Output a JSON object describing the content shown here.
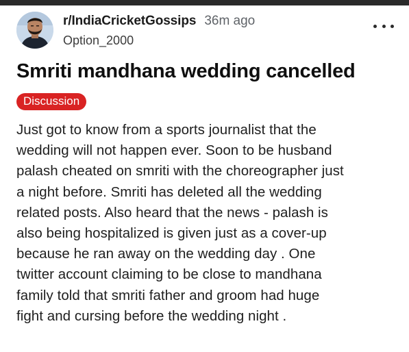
{
  "post": {
    "subreddit": "r/IndiaCricketGossips",
    "time_ago": "36m ago",
    "username": "Option_2000",
    "title": "Smriti mandhana wedding cancelled",
    "flair": "Discussion",
    "body_lines": [
      "Just got to know from a sports journalist that the",
      "wedding will not happen ever. Soon to be husband",
      "palash cheated on smriti with the choreographer just",
      "a night before. Smriti has deleted all the wedding",
      "related posts. Also heard that the news - palash is",
      "also being hospitalized is given just as a cover-up",
      "because he ran away on the wedding day . One",
      "twitter account claiming to be close to mandhana",
      "family told that smriti father and groom had huge",
      "fight and cursing before the wedding night ."
    ],
    "icons": {
      "avatar": "user-avatar",
      "more": "more-options-icon"
    },
    "colors": {
      "flair_bg": "#d92323",
      "text": "#1e1e1e",
      "meta": "#5f6368"
    }
  }
}
